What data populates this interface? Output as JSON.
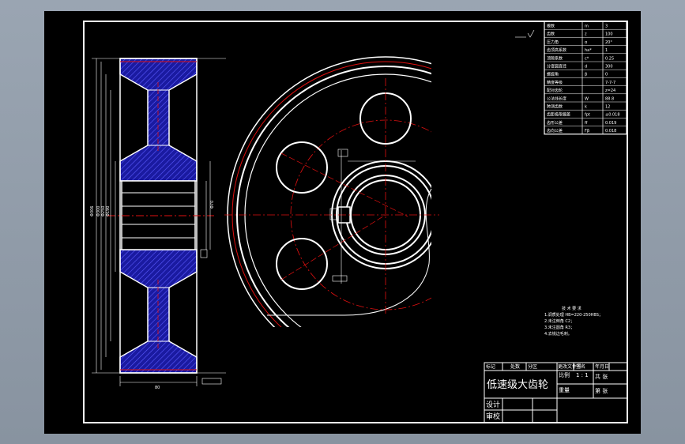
{
  "title_block": {
    "part_name": "低速级大齿轮",
    "row_labels": [
      "设计",
      "审校"
    ],
    "header_cells": [
      "标记",
      "处数",
      "分区",
      "更改文件号",
      "签名",
      "年月日"
    ],
    "scale_label": "比例",
    "scale_value": "1 : 1",
    "weight_label": "重量",
    "sheet_label": "共 张",
    "sheet_label_2": "第 张"
  },
  "tech_notes": {
    "heading": "技 术 要 求",
    "lines": [
      "1.调质处理 HB=220-250HBS；",
      "2.未注倒角 C2；",
      "3.未注圆角 R3；",
      "4.去锐边毛刺。"
    ]
  },
  "params_table": {
    "rows": [
      [
        "模数",
        "m",
        "3"
      ],
      [
        "齿数",
        "z",
        "100"
      ],
      [
        "压力角",
        "α",
        "20°"
      ],
      [
        "齿顶高系数",
        "ha*",
        "1"
      ],
      [
        "顶隙系数",
        "c*",
        "0.25"
      ],
      [
        "分度圆直径",
        "d",
        "300"
      ],
      [
        "螺旋角",
        "β",
        "0"
      ],
      [
        "精度等级",
        "",
        "7-7-7"
      ],
      [
        "配对齿轮",
        "",
        "z=24"
      ],
      [
        "公法线长度",
        "W",
        "88.8"
      ],
      [
        "跨测齿数",
        "k",
        "12"
      ],
      [
        "齿距极限偏差",
        "fpt",
        "±0.018"
      ],
      [
        "齿形公差",
        "ff",
        "0.019"
      ],
      [
        "齿向公差",
        "Fβ",
        "0.018"
      ]
    ]
  },
  "colors": {
    "background": "#000000",
    "lines": "#ffffff",
    "center_lines": "#e01010",
    "hatch": "#1a1aa0"
  }
}
